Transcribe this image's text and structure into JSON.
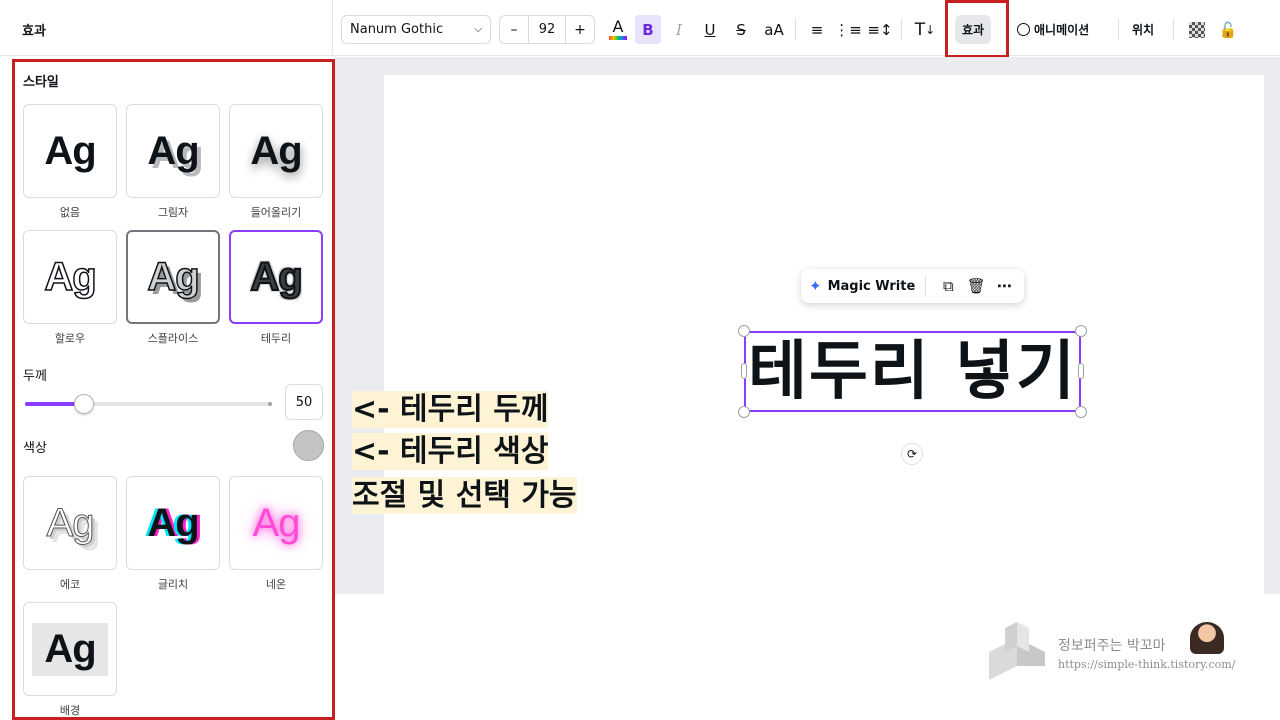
{
  "panel": {
    "title": "효과",
    "style_label": "스타일",
    "tiles": [
      {
        "ag": "Ag",
        "caption": "없음"
      },
      {
        "ag": "Ag",
        "caption": "그림자"
      },
      {
        "ag": "Ag",
        "caption": "들어올리기"
      },
      {
        "ag": "Ag",
        "caption": "할로우"
      },
      {
        "ag": "Ag",
        "caption": "스플라이스"
      },
      {
        "ag": "Ag",
        "caption": "테두리"
      }
    ],
    "thickness_label": "두께",
    "thickness_value": "50",
    "thickness_fraction": 0.24,
    "color_label": "색상",
    "color_value": "#c4c4c4",
    "tiles2": [
      {
        "ag": "Ag",
        "caption": "에코"
      },
      {
        "ag": "Ag",
        "caption": "글리치"
      },
      {
        "ag": "Ag",
        "caption": "네온"
      },
      {
        "ag": "Ag",
        "caption": "배경"
      }
    ]
  },
  "toolbar": {
    "font_name": "Nanum Gothic",
    "font_size": "92",
    "minus": "–",
    "plus": "+",
    "text_color_glyph": "A",
    "bold": "B",
    "italic": "I",
    "underline": "U",
    "strike": "S",
    "case": "aA",
    "vertical_text": "T",
    "effects": "효과",
    "animate": "애니메이션",
    "position": "위치"
  },
  "floating_toolbar": {
    "magic_write": "Magic Write"
  },
  "canvas": {
    "selected_text": "테두리 넣기"
  },
  "annotation": {
    "line1": "<- 테두리 두께",
    "line2": "<- 테두리 색상",
    "line3": "조절 및 선택 가능"
  },
  "watermark": {
    "name": "정보퍼주는 박꼬마",
    "url": "https://simple-think.tistory.com/"
  },
  "colors": {
    "accent": "#8b3dff",
    "highlight_border": "#c62020",
    "annotation_bg": "#fff3d6"
  }
}
